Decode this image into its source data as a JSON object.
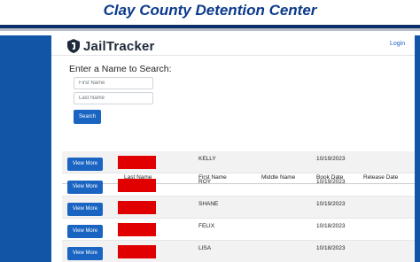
{
  "banner": {
    "title": "Clay County Detention Center"
  },
  "colors": {
    "navy": "#0b3a8c",
    "side_blue": "#1155a6",
    "button_blue": "#1a64c2",
    "redaction_red": "#e00000"
  },
  "nav": {
    "logo_text": "JailTracker",
    "logo_icon": "shield-icon",
    "login_label": "Login"
  },
  "search": {
    "title": "Enter a Name to Search:",
    "first_name_placeholder": "First Name",
    "last_name_placeholder": "Last Name",
    "first_name_value": "",
    "last_name_value": "",
    "button_label": "Search"
  },
  "table": {
    "columns": [
      "",
      "Last Name",
      "First Name",
      "Middle Name",
      "Book Date",
      "Release Date"
    ],
    "view_button_label": "View More",
    "rows": [
      {
        "last_name_redacted": true,
        "first_name": "KELLY",
        "middle_name": "",
        "book_date": "10/19/2023",
        "release_date": ""
      },
      {
        "last_name_redacted": true,
        "first_name": "ROY",
        "middle_name": "",
        "book_date": "10/19/2023",
        "release_date": ""
      },
      {
        "last_name_redacted": true,
        "first_name": "SHANE",
        "middle_name": "",
        "book_date": "10/19/2023",
        "release_date": ""
      },
      {
        "last_name_redacted": true,
        "first_name": "FELIX",
        "middle_name": "",
        "book_date": "10/18/2023",
        "release_date": ""
      },
      {
        "last_name_redacted": true,
        "first_name": "LISA",
        "middle_name": "",
        "book_date": "10/18/2023",
        "release_date": ""
      }
    ]
  }
}
